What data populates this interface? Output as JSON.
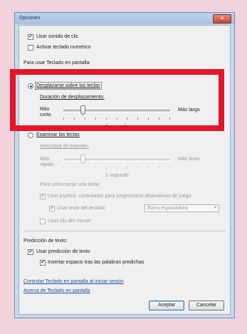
{
  "window": {
    "title": "Opciones",
    "close_glyph": "✕"
  },
  "options": {
    "clic_sound_label": "Usar sonido de clic",
    "clic_sound_checked": true,
    "numeric_keypad_label": "Activar teclado numérico",
    "numeric_keypad_checked": false
  },
  "mode_section": {
    "heading": "Para usar Teclado en pantalla:",
    "hover_option_label": "Desplazarse sobre las teclas",
    "hover_option_selected": true,
    "scan_option_label": "Examinar las teclas",
    "scan_option_selected": false
  },
  "hover_duration": {
    "label": "Duración de desplazamiento:",
    "left_label_line1": "Más",
    "left_label_line2": "corto",
    "right_label": "Más largo",
    "value_label": "1 segundo",
    "level_fraction": 0.18
  },
  "scan_speed": {
    "label": "Velocidad de examen:",
    "left_label_line1": "Más",
    "left_label_line2": "rápido",
    "right_label": "Más lento",
    "value_label": "1 segundo",
    "level_fraction": 0.18
  },
  "select_key": {
    "heading": "Para seleccionar una tecla:",
    "joystick_label": "Usar joystick, controlador para juegos/otros dispositivos de juego",
    "joystick_checked": true,
    "keyboard_key_label": "Usar tecla del teclado",
    "keyboard_key_checked": true,
    "keyboard_key_select_value": "Barra espaciadora",
    "mouse_click_label": "Usar clic del mouse",
    "mouse_click_checked": false
  },
  "prediction": {
    "heading": "Predicción de texto:",
    "use_prediction_label": "Usar predicción de texto",
    "use_prediction_checked": true,
    "insert_space_label": "Insertar espacio tras las palabras predichas",
    "insert_space_checked": true
  },
  "links": {
    "control_at_login": "Controlar Teclado en pantalla al iniciar sesión",
    "about": "Acerca de Teclado en pantalla"
  },
  "buttons": {
    "accept": "Aceptar",
    "cancel": "Cancelar"
  },
  "colors": {
    "highlight": "#e4142b",
    "page_background": "#f2d3dc"
  },
  "icons": {
    "check": "✔",
    "dropdown": "▾"
  }
}
